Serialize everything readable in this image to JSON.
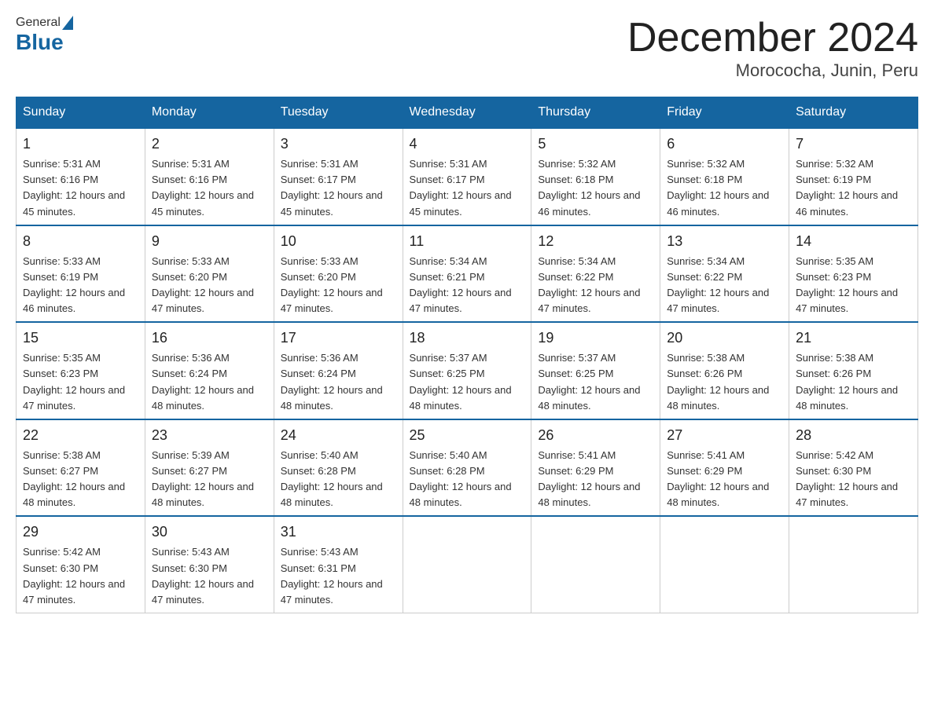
{
  "header": {
    "logo_general": "General",
    "logo_blue": "Blue",
    "month_title": "December 2024",
    "location": "Morococha, Junin, Peru"
  },
  "days_of_week": [
    "Sunday",
    "Monday",
    "Tuesday",
    "Wednesday",
    "Thursday",
    "Friday",
    "Saturday"
  ],
  "weeks": [
    [
      {
        "day": "1",
        "sunrise": "5:31 AM",
        "sunset": "6:16 PM",
        "daylight": "12 hours and 45 minutes."
      },
      {
        "day": "2",
        "sunrise": "5:31 AM",
        "sunset": "6:16 PM",
        "daylight": "12 hours and 45 minutes."
      },
      {
        "day": "3",
        "sunrise": "5:31 AM",
        "sunset": "6:17 PM",
        "daylight": "12 hours and 45 minutes."
      },
      {
        "day": "4",
        "sunrise": "5:31 AM",
        "sunset": "6:17 PM",
        "daylight": "12 hours and 45 minutes."
      },
      {
        "day": "5",
        "sunrise": "5:32 AM",
        "sunset": "6:18 PM",
        "daylight": "12 hours and 46 minutes."
      },
      {
        "day": "6",
        "sunrise": "5:32 AM",
        "sunset": "6:18 PM",
        "daylight": "12 hours and 46 minutes."
      },
      {
        "day": "7",
        "sunrise": "5:32 AM",
        "sunset": "6:19 PM",
        "daylight": "12 hours and 46 minutes."
      }
    ],
    [
      {
        "day": "8",
        "sunrise": "5:33 AM",
        "sunset": "6:19 PM",
        "daylight": "12 hours and 46 minutes."
      },
      {
        "day": "9",
        "sunrise": "5:33 AM",
        "sunset": "6:20 PM",
        "daylight": "12 hours and 47 minutes."
      },
      {
        "day": "10",
        "sunrise": "5:33 AM",
        "sunset": "6:20 PM",
        "daylight": "12 hours and 47 minutes."
      },
      {
        "day": "11",
        "sunrise": "5:34 AM",
        "sunset": "6:21 PM",
        "daylight": "12 hours and 47 minutes."
      },
      {
        "day": "12",
        "sunrise": "5:34 AM",
        "sunset": "6:22 PM",
        "daylight": "12 hours and 47 minutes."
      },
      {
        "day": "13",
        "sunrise": "5:34 AM",
        "sunset": "6:22 PM",
        "daylight": "12 hours and 47 minutes."
      },
      {
        "day": "14",
        "sunrise": "5:35 AM",
        "sunset": "6:23 PM",
        "daylight": "12 hours and 47 minutes."
      }
    ],
    [
      {
        "day": "15",
        "sunrise": "5:35 AM",
        "sunset": "6:23 PM",
        "daylight": "12 hours and 47 minutes."
      },
      {
        "day": "16",
        "sunrise": "5:36 AM",
        "sunset": "6:24 PM",
        "daylight": "12 hours and 48 minutes."
      },
      {
        "day": "17",
        "sunrise": "5:36 AM",
        "sunset": "6:24 PM",
        "daylight": "12 hours and 48 minutes."
      },
      {
        "day": "18",
        "sunrise": "5:37 AM",
        "sunset": "6:25 PM",
        "daylight": "12 hours and 48 minutes."
      },
      {
        "day": "19",
        "sunrise": "5:37 AM",
        "sunset": "6:25 PM",
        "daylight": "12 hours and 48 minutes."
      },
      {
        "day": "20",
        "sunrise": "5:38 AM",
        "sunset": "6:26 PM",
        "daylight": "12 hours and 48 minutes."
      },
      {
        "day": "21",
        "sunrise": "5:38 AM",
        "sunset": "6:26 PM",
        "daylight": "12 hours and 48 minutes."
      }
    ],
    [
      {
        "day": "22",
        "sunrise": "5:38 AM",
        "sunset": "6:27 PM",
        "daylight": "12 hours and 48 minutes."
      },
      {
        "day": "23",
        "sunrise": "5:39 AM",
        "sunset": "6:27 PM",
        "daylight": "12 hours and 48 minutes."
      },
      {
        "day": "24",
        "sunrise": "5:40 AM",
        "sunset": "6:28 PM",
        "daylight": "12 hours and 48 minutes."
      },
      {
        "day": "25",
        "sunrise": "5:40 AM",
        "sunset": "6:28 PM",
        "daylight": "12 hours and 48 minutes."
      },
      {
        "day": "26",
        "sunrise": "5:41 AM",
        "sunset": "6:29 PM",
        "daylight": "12 hours and 48 minutes."
      },
      {
        "day": "27",
        "sunrise": "5:41 AM",
        "sunset": "6:29 PM",
        "daylight": "12 hours and 48 minutes."
      },
      {
        "day": "28",
        "sunrise": "5:42 AM",
        "sunset": "6:30 PM",
        "daylight": "12 hours and 47 minutes."
      }
    ],
    [
      {
        "day": "29",
        "sunrise": "5:42 AM",
        "sunset": "6:30 PM",
        "daylight": "12 hours and 47 minutes."
      },
      {
        "day": "30",
        "sunrise": "5:43 AM",
        "sunset": "6:30 PM",
        "daylight": "12 hours and 47 minutes."
      },
      {
        "day": "31",
        "sunrise": "5:43 AM",
        "sunset": "6:31 PM",
        "daylight": "12 hours and 47 minutes."
      },
      null,
      null,
      null,
      null
    ]
  ],
  "labels": {
    "sunrise": "Sunrise:",
    "sunset": "Sunset:",
    "daylight": "Daylight:"
  }
}
